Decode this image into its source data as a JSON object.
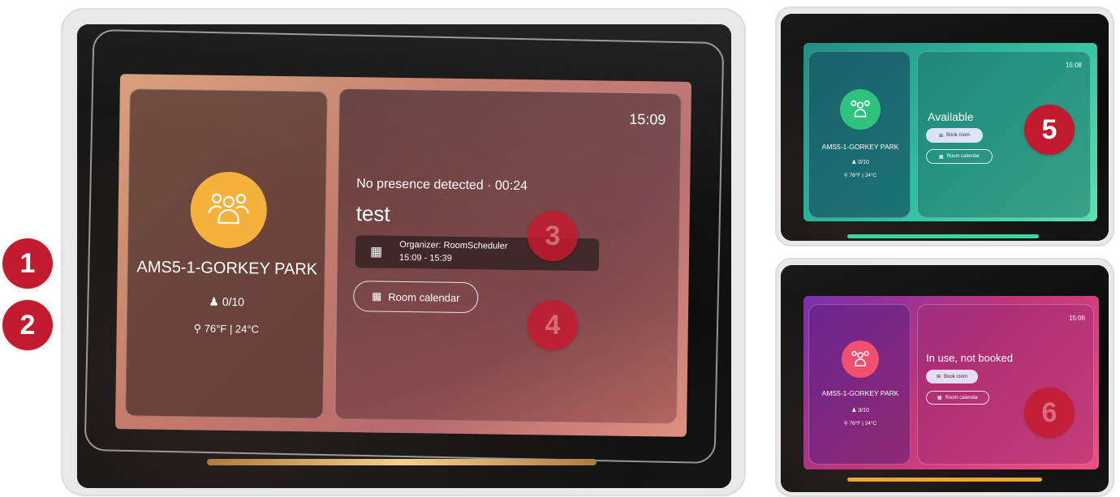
{
  "callouts": [
    "1",
    "2",
    "3",
    "4",
    "5",
    "6"
  ],
  "main_device": {
    "room_name": "AMS5-1-GORKEY PARK",
    "occupancy": "0/10",
    "temperature": "76°F | 24°C",
    "time": "15:09",
    "presence_status": "No presence detected · 00:24",
    "meeting_title": "test",
    "organizer": "Organizer: RoomScheduler",
    "meeting_time": "15:09 - 15:39",
    "room_calendar_label": "Room calendar",
    "accent_color": "#f4b23c"
  },
  "available_device": {
    "room_name": "AMS5-1-GORKEY PARK",
    "occupancy": "0/10",
    "temperature": "76°F | 24°C",
    "time": "15:08",
    "status": "Available",
    "book_room_label": "Book room",
    "room_calendar_label": "Room calendar",
    "accent_color": "#2ec27e"
  },
  "inuse_device": {
    "room_name": "AMS5-1-GORKEY PARK",
    "occupancy": "3/10",
    "temperature": "76°F | 24°C",
    "time": "15:06",
    "status": "In use, not booked",
    "book_room_label": "Book room",
    "room_calendar_label": "Room calendar",
    "accent_color": "#f0506e"
  }
}
